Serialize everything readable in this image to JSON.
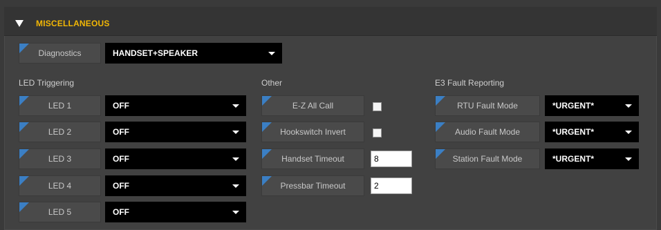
{
  "section": {
    "title": "MISCELLANEOUS"
  },
  "diagnostics": {
    "label": "Diagnostics",
    "value": "HANDSET+SPEAKER"
  },
  "led_triggering": {
    "title": "LED Triggering",
    "rows": [
      {
        "label": "LED 1",
        "value": "OFF"
      },
      {
        "label": "LED 2",
        "value": "OFF"
      },
      {
        "label": "LED 3",
        "value": "OFF"
      },
      {
        "label": "LED 4",
        "value": "OFF"
      },
      {
        "label": "LED 5",
        "value": "OFF"
      }
    ]
  },
  "other": {
    "title": "Other",
    "ez_all_call": {
      "label": "E-Z All Call",
      "checked": false
    },
    "hookswitch_invert": {
      "label": "Hookswitch Invert",
      "checked": false
    },
    "handset_timeout": {
      "label": "Handset Timeout",
      "value": "8"
    },
    "pressbar_timeout": {
      "label": "Pressbar Timeout",
      "value": "2"
    }
  },
  "e3_fault": {
    "title": "E3 Fault Reporting",
    "rows": [
      {
        "label": "RTU Fault Mode",
        "value": "*URGENT*"
      },
      {
        "label": "Audio Fault Mode",
        "value": "*URGENT*"
      },
      {
        "label": "Station Fault Mode",
        "value": "*URGENT*"
      }
    ]
  },
  "colors": {
    "accent": "#f2b705",
    "corner": "#3b7fc4",
    "panel": "#414141"
  }
}
